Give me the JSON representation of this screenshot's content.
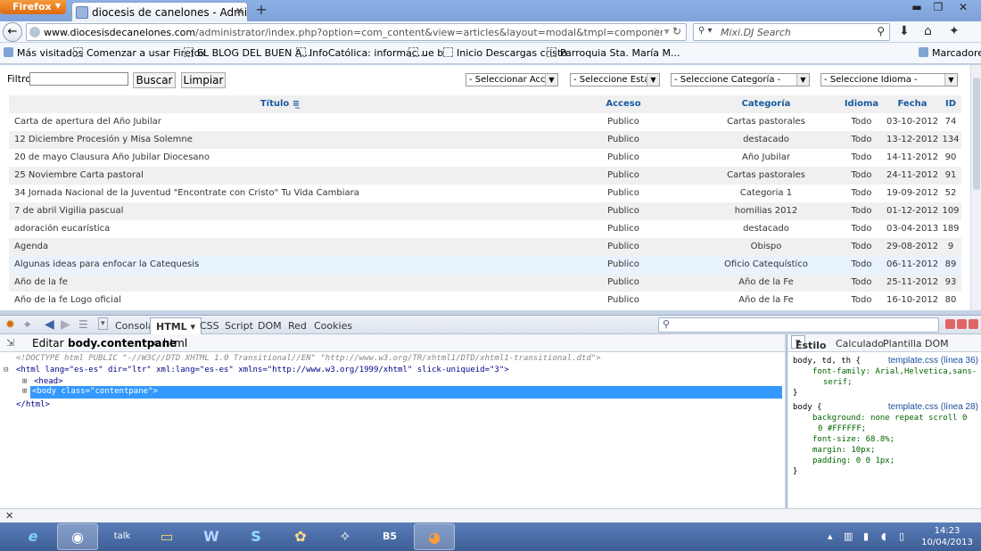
{
  "browser": {
    "menu_button": "Firefox",
    "tab_title": "diocesis de canelones - Administración",
    "url_domain": "www.diocesisdecanelones.com",
    "url_path": "/administrator/index.php?option=com_content&view=articles&layout=modal&tmpl=component&function=jSelectArticle_jfo",
    "search_placeholder": "Mixi.DJ Search",
    "bookmarks": [
      "Más visitados",
      "Comenzar a usar Firefox",
      "EL BLOG DEL BUEN A...",
      "InfoCatólica: informac...",
      "ue b",
      "Inicio Descargas cristo",
      "Parroquia Sta. María M...",
      "Marcadores"
    ]
  },
  "page": {
    "filter_label": "Filtro:",
    "filter_value": "",
    "search_button": "Buscar",
    "clear_button": "Limpiar",
    "selects": [
      "- Seleccionar Acceso -",
      "- Seleccione Estado -",
      "- Seleccione Categoría -",
      "- Seleccione Idioma -"
    ],
    "columns": {
      "title": "Título",
      "access": "Acceso",
      "category": "Categoría",
      "language": "Idioma",
      "date": "Fecha",
      "id": "ID"
    },
    "rows": [
      {
        "title": "Carta de apertura del Año Jubilar",
        "access": "Publico",
        "category": "Cartas pastorales",
        "language": "Todo",
        "date": "03-10-2012",
        "id": "74"
      },
      {
        "title": "12 Diciembre Procesión y Misa Solemne",
        "access": "Publico",
        "category": "destacado",
        "language": "Todo",
        "date": "13-12-2012",
        "id": "134"
      },
      {
        "title": "20 de mayo Clausura Año Jubilar Diocesano",
        "access": "Publico",
        "category": "Año Jubilar",
        "language": "Todo",
        "date": "14-11-2012",
        "id": "90"
      },
      {
        "title": "25 Noviembre Carta pastoral",
        "access": "Publico",
        "category": "Cartas pastorales",
        "language": "Todo",
        "date": "24-11-2012",
        "id": "91"
      },
      {
        "title": "34 Jornada Nacional de la Juventud \"Encontrate con Cristo\" Tu Vida Cambiara",
        "access": "Publico",
        "category": "Categoria 1",
        "language": "Todo",
        "date": "19-09-2012",
        "id": "52"
      },
      {
        "title": "7 de abril Vigilia pascual",
        "access": "Publico",
        "category": "homilias 2012",
        "language": "Todo",
        "date": "01-12-2012",
        "id": "109"
      },
      {
        "title": "adoración eucarística",
        "access": "Publico",
        "category": "destacado",
        "language": "Todo",
        "date": "03-04-2013",
        "id": "189"
      },
      {
        "title": "Agenda",
        "access": "Publico",
        "category": "Obispo",
        "language": "Todo",
        "date": "29-08-2012",
        "id": "9"
      },
      {
        "title": "Algunas ideas para enfocar la Catequesis",
        "access": "Publico",
        "category": "Oficio Catequístico",
        "language": "Todo",
        "date": "06-11-2012",
        "id": "89"
      },
      {
        "title": "Año de la fe",
        "access": "Publico",
        "category": "Año de la Fe",
        "language": "Todo",
        "date": "25-11-2012",
        "id": "93"
      },
      {
        "title": "Año de la fe Logo oficial",
        "access": "Publico",
        "category": "Año de la Fe",
        "language": "Todo",
        "date": "16-10-2012",
        "id": "80"
      }
    ]
  },
  "firebug": {
    "tabs": [
      "Consola",
      "HTML",
      "CSS",
      "Script",
      "DOM",
      "Red",
      "Cookies"
    ],
    "active_tab": "HTML",
    "edit_label": "Editar",
    "breadcrumb_current": "body.contentpane",
    "breadcrumb_parent": "< html",
    "doctype": "<!DOCTYPE html PUBLIC \"-//W3C//DTD XHTML 1.0 Transitional//EN\" \"http://www.w3.org/TR/xhtml1/DTD/xhtml1-transitional.dtd\">",
    "html_open": "<html lang=\"es-es\" dir=\"ltr\" xml:lang=\"es-es\" xmlns=\"http://www.w3.org/1999/xhtml\" slick-uniqueid=\"3\">",
    "head": "<head>",
    "body": "<body class=\"contentpane\">",
    "html_close": "</html>",
    "side_tabs": [
      "Estilo",
      "Calculado",
      "Plantilla",
      "DOM"
    ],
    "rule1_selector": "body, td, th {",
    "rule1_source": "template.css (línea 36)",
    "rule1_decl1": "font-family: Arial,Helvetica,sans-",
    "rule1_decl1b": "serif;",
    "rule2_selector": "body {",
    "rule2_source": "template.css (línea 28)",
    "rule2_decl1": "background: none repeat scroll 0",
    "rule2_decl1b": "0 #FFFFFF;",
    "rule2_decl2": "font-size: 68.8%;",
    "rule2_decl3": "margin: 10px;",
    "rule2_decl4": "padding: 0 0 1px;",
    "close_brace": "}"
  },
  "taskbar": {
    "time": "14:23",
    "date": "10/04/2013",
    "apps": [
      "ie-icon",
      "chrome-icon",
      "talk-icon",
      "explorer-icon",
      "word-icon",
      "skype-icon",
      "picasa-icon",
      "tool-icon",
      "b5-icon",
      "firefox-icon"
    ]
  }
}
